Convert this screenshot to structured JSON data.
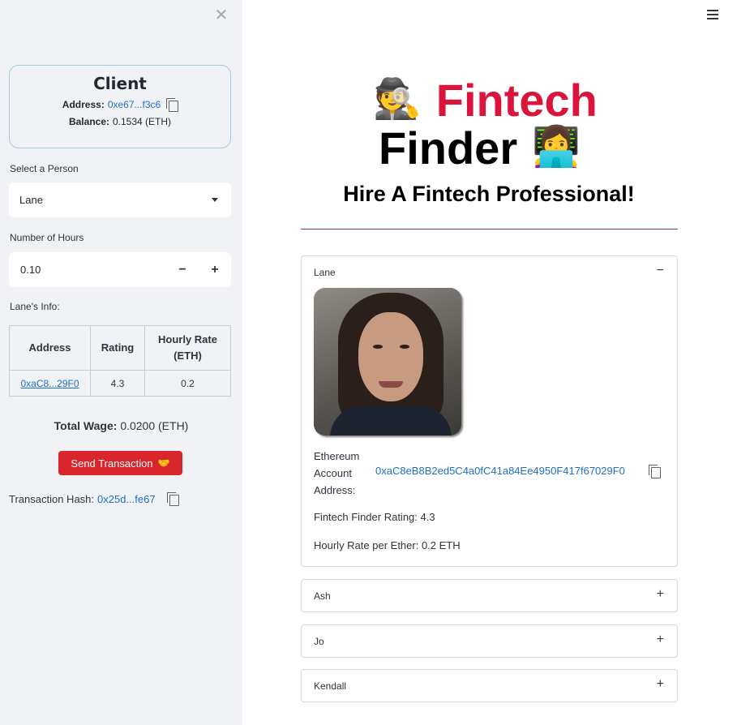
{
  "sidebar": {
    "close_icon": "close-icon",
    "client": {
      "title": "Client",
      "address_label": "Address:",
      "address_value": "0xe67...f3c6",
      "balance_label": "Balance:",
      "balance_value": "0.1534 (ETH)"
    },
    "select_person": {
      "label": "Select a Person",
      "value": "Lane"
    },
    "hours": {
      "label": "Number of Hours",
      "value": "0.10",
      "minus": "−",
      "plus": "+"
    },
    "info": {
      "title": "Lane's Info:",
      "headers": [
        "Address",
        "Rating",
        "Hourly Rate (ETH)"
      ],
      "row": {
        "address": "0xaC8...29F0",
        "rating": "4.3",
        "rate": "0.2"
      }
    },
    "total_wage": {
      "label": "Total Wage:",
      "value": "0.0200 (ETH)"
    },
    "send_button": {
      "label": "Send Transaction",
      "emoji": "🤝"
    },
    "tx_hash": {
      "label": "Transaction Hash:",
      "value": "0x25d...fe67"
    }
  },
  "main": {
    "menu_icon": "hamburger-menu-icon",
    "hero": {
      "emoji_detective": "🕵️",
      "word1": "Fintech",
      "word2": "Finder",
      "emoji_technologist": "👩‍💻"
    },
    "subtitle": "Hire A Fintech Professional!",
    "expanders": [
      {
        "name": "Lane",
        "toggle": "−",
        "expanded": true,
        "eth_label_line1": "Ethereum",
        "eth_label_line2": "Account",
        "eth_label_line3": "Address:",
        "eth_address": "0xaC8eB8B2ed5C4a0fC41a84Ee4950F417f67029F0",
        "rating_text": "Fintech Finder Rating: 4.3",
        "rate_text": "Hourly Rate per Ether: 0.2 ETH"
      },
      {
        "name": "Ash",
        "toggle": "+"
      },
      {
        "name": "Jo",
        "toggle": "+"
      },
      {
        "name": "Kendall",
        "toggle": "+"
      }
    ]
  },
  "colors": {
    "sidebar_bg": "#f0f2f6",
    "accent_red": "#dc143c",
    "button_red": "#d8262c",
    "link_blue": "#1f6fc5"
  }
}
